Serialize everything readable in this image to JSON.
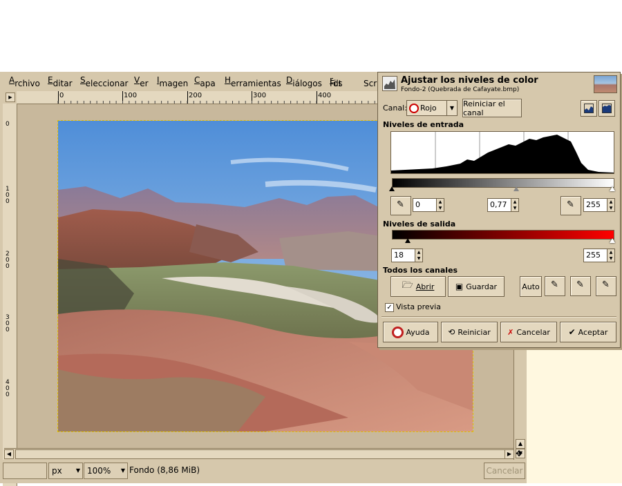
{
  "menu": {
    "items": [
      {
        "pre": "",
        "u": "A",
        "post": "rchivo"
      },
      {
        "pre": "",
        "u": "E",
        "post": "ditar"
      },
      {
        "pre": "",
        "u": "S",
        "post": "eleccionar"
      },
      {
        "pre": "",
        "u": "V",
        "post": "er"
      },
      {
        "pre": "",
        "u": "I",
        "post": "magen"
      },
      {
        "pre": "",
        "u": "C",
        "post": "apa"
      },
      {
        "pre": "",
        "u": "H",
        "post": "erramientas"
      },
      {
        "pre": "",
        "u": "D",
        "post": "iálogos"
      },
      {
        "pre": "Filt",
        "u": "r",
        "post": "os"
      },
      {
        "pre": "Scr",
        "u": "",
        "post": ""
      }
    ]
  },
  "ruler": {
    "h_ticks": [
      "0",
      "100",
      "200",
      "300",
      "400"
    ],
    "v_ticks": [
      "0",
      "100",
      "200",
      "300",
      "400"
    ]
  },
  "status": {
    "unit": "px",
    "zoom": "100%",
    "layer_info": "Fondo (8,86 MiB)",
    "cancel": "Cancelar"
  },
  "dialog": {
    "title": "Ajustar los niveles de color",
    "subtitle": "Fondo-2 (Quebrada de Cafayate.bmp)",
    "channel_label": "Canal:",
    "channel_value": "Rojo",
    "reset_channel": "Reiniciar el canal",
    "input_levels": "Niveles de entrada",
    "input_low": "0",
    "input_gamma": "0,77",
    "input_high": "255",
    "output_levels": "Niveles de salida",
    "output_low": "18",
    "output_high": "255",
    "all_channels": "Todos los canales",
    "open": "Abrir",
    "save": "Guardar",
    "auto": "Auto",
    "preview": "Vista previa",
    "help": "Ayuda",
    "reset": "Reiniciar",
    "cancel": "Cancelar",
    "accept": "Aceptar"
  }
}
